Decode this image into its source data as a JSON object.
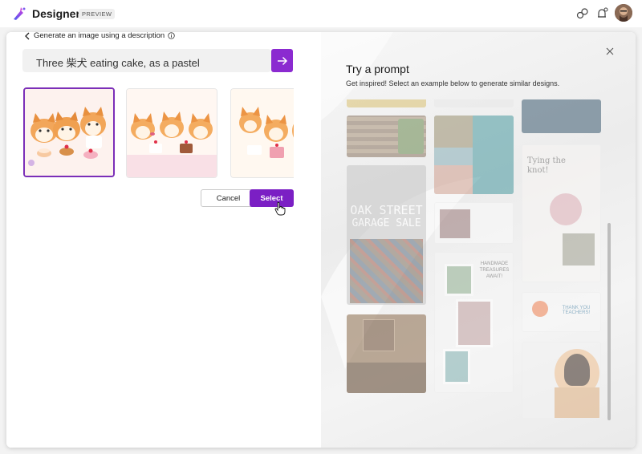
{
  "app": {
    "title": "Designer",
    "badge": "PREVIEW"
  },
  "left": {
    "back_label": "Generate an image using a description",
    "prompt_value": "Three 柴犬 eating cake, as a pastel",
    "cancel_label": "Cancel",
    "select_label": "Select"
  },
  "right": {
    "title": "Try a prompt",
    "subtitle": "Get inspired! Select an example below to generate similar designs.",
    "cards": {
      "garage_line1": "OAK STREET",
      "garage_line2": "GARAGE SALE",
      "tying": "Tying the knot!",
      "treasures": "HANDMADE TREASURES AWAIT!",
      "teachers": "THANK YOU TEACHERS!"
    }
  },
  "colors": {
    "accent": "#8b2ad0",
    "select": "#7b1fc4"
  }
}
